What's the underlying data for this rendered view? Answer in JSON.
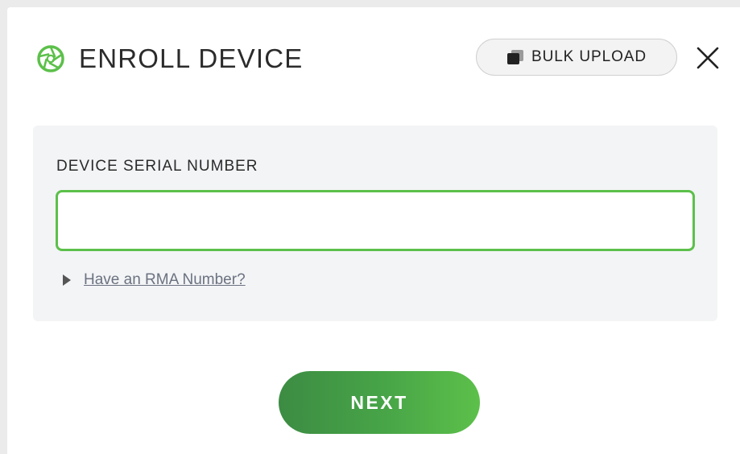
{
  "modal": {
    "title": "ENROLL DEVICE",
    "title_icon": "aperture-logo-icon",
    "accent_color": "#5cc04a"
  },
  "header": {
    "bulk_upload_label": "BULK UPLOAD",
    "bulk_upload_icon": "stacked-cards-icon",
    "close_icon": "close-icon"
  },
  "form": {
    "serial_label": "DEVICE SERIAL NUMBER",
    "serial_value": "",
    "serial_placeholder": "",
    "rma_link": "Have an RMA Number?",
    "rma_icon": "caret-right-icon"
  },
  "footer": {
    "next_label": "NEXT"
  }
}
